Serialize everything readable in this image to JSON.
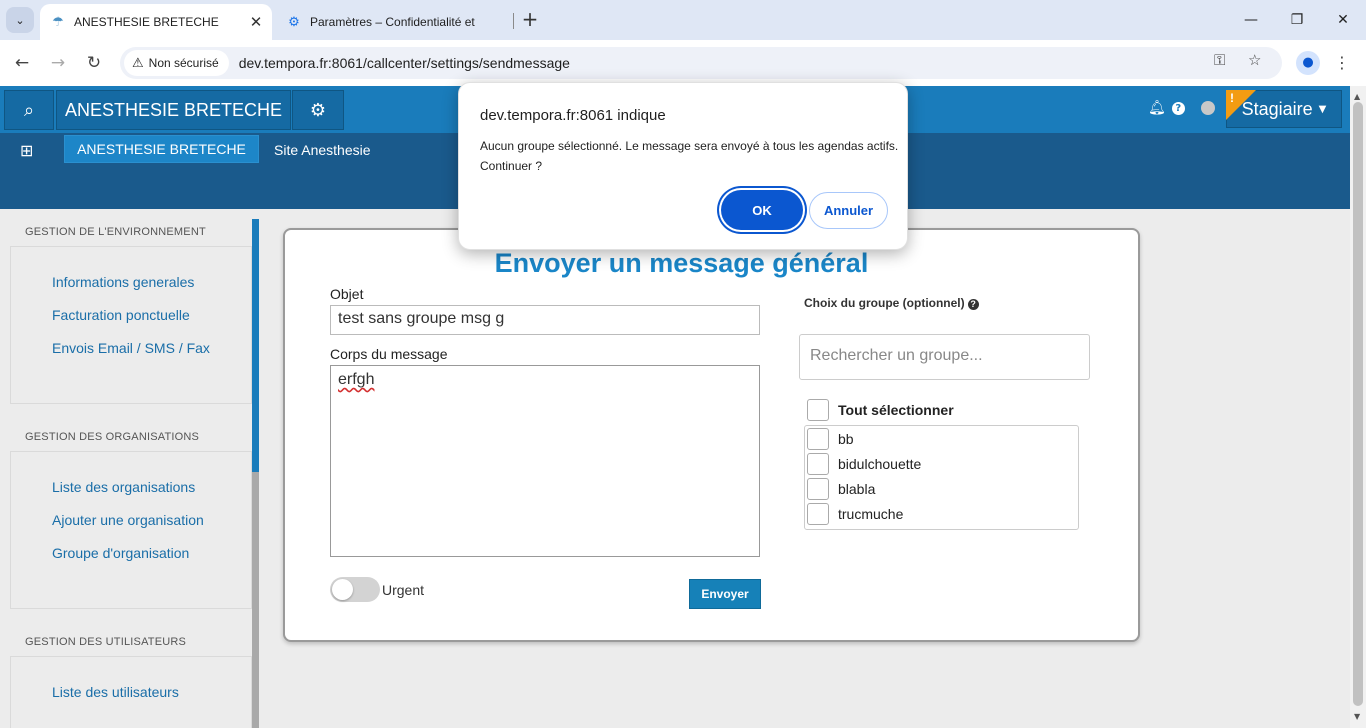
{
  "browser": {
    "tabs": [
      {
        "title": "ANESTHESIE BRETECHE",
        "favicon": "tempora-umbrella-icon"
      },
      {
        "title": "Paramètres – Confidentialité et",
        "favicon": "chrome-settings-gear-icon"
      }
    ],
    "security_label": "Non sécurisé",
    "url": "dev.tempora.fr:8061/callcenter/settings/sendmessage"
  },
  "topnav": {
    "app_title": "ANESTHESIE BRETECHE",
    "user_label": "Stagiaire",
    "user_flag": "!"
  },
  "subnav": {
    "active_item": "ANESTHESIE BRETECHE",
    "site_link": "Site Anesthesie"
  },
  "sidebar": {
    "sections": [
      {
        "heading": "GESTION DE L'ENVIRONNEMENT",
        "links": [
          "Informations generales",
          "Facturation ponctuelle",
          "Envois Email / SMS / Fax"
        ]
      },
      {
        "heading": "GESTION DES ORGANISATIONS",
        "links": [
          "Liste des organisations",
          "Ajouter une organisation",
          "Groupe d'organisation"
        ]
      },
      {
        "heading": "GESTION DES UTILISATEURS",
        "links": [
          "Liste des utilisateurs"
        ]
      }
    ]
  },
  "form": {
    "title": "Envoyer un message général",
    "subject_label": "Objet",
    "subject_value": "test sans groupe msg g",
    "body_label": "Corps du message",
    "body_value": "erfgh",
    "urgent_label": "Urgent",
    "urgent_on": false,
    "send_label": "Envoyer",
    "group_label": "Choix du groupe (optionnel)",
    "group_search_placeholder": "Rechercher un groupe...",
    "select_all_label": "Tout sélectionner",
    "groups": [
      "bb",
      "bidulchouette",
      "blabla",
      "trucmuche"
    ]
  },
  "dialog": {
    "title": "dev.tempora.fr:8061 indique",
    "message": "Aucun groupe sélectionné. Le message sera envoyé à tous les agendas actifs. Continuer ?",
    "ok_label": "OK",
    "cancel_label": "Annuler"
  },
  "colors": {
    "primary_blue": "#1a7cbb",
    "subnav_blue": "#1a5a8c",
    "title_blue": "#1a86c8",
    "dialog_button_blue": "#0b57d0"
  }
}
